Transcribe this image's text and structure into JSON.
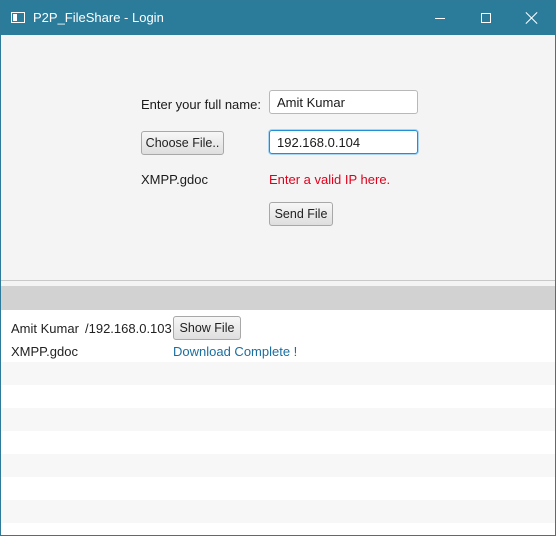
{
  "window": {
    "title": "P2P_FileShare - Login",
    "controls": {
      "minimize": "minimize",
      "maximize": "maximize",
      "close": "close"
    }
  },
  "form": {
    "name_label": "Enter your full name:",
    "name_value": "Amit Kumar",
    "choose_file_label": "Choose File..",
    "ip_value": "192.168.0.104",
    "selected_file": "XMPP.gdoc",
    "ip_error": "Enter a valid IP here.",
    "send_label": "Send File"
  },
  "transfers": {
    "items": [
      {
        "name": "Amit Kumar",
        "ip": "/192.168.0.103",
        "show_label": "Show File",
        "file": "XMPP.gdoc",
        "status": "Download Complete !"
      }
    ]
  },
  "colors": {
    "titlebar": "#2b7c9a",
    "error": "#e0001b",
    "status": "#1a6ea0",
    "focus": "#1f8fd8"
  }
}
